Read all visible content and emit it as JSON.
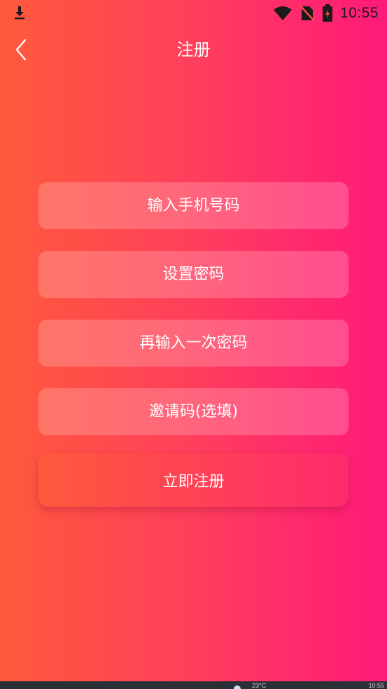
{
  "status_bar": {
    "time": "10:55",
    "icons": [
      "download-icon",
      "wifi-icon",
      "no-sim-icon",
      "battery-charging-icon"
    ]
  },
  "header": {
    "title": "注册",
    "back_icon": "chevron-left-icon"
  },
  "form": {
    "phone_placeholder": "输入手机号码",
    "password_placeholder": "设置密码",
    "confirm_password_placeholder": "再输入一次密码",
    "invite_code_placeholder": "邀请码(选填)",
    "submit_label": "立即注册"
  },
  "taskbar": {
    "temperature": "23°C",
    "clock": "10:55"
  },
  "colors": {
    "gradient_start": "#ff5a3c",
    "gradient_end": "#ff1a7a",
    "text": "#ffffff"
  }
}
